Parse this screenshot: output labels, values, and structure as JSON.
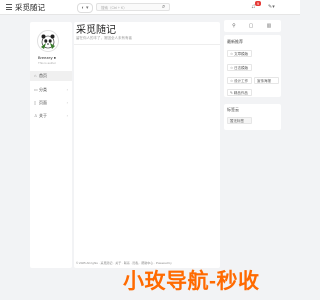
{
  "header": {
    "site_title": "采觅随记",
    "theme_label": "◐ ▾",
    "search_placeholder": "搜索（Ctrl + K）",
    "notify_count": "9"
  },
  "profile": {
    "name": "Breezey ●",
    "subtitle": "This is author"
  },
  "nav": {
    "items": [
      {
        "label": "首页",
        "icon": "home-icon"
      },
      {
        "label": "分类",
        "icon": "folder-icon"
      },
      {
        "label": "页面",
        "icon": "page-icon"
      },
      {
        "label": "关于",
        "icon": "person-icon"
      }
    ]
  },
  "main": {
    "title": "采觅随记",
    "subtitle": "留在你人的丰了，常因全人未有有者"
  },
  "right": {
    "tools_title": "最新推荐",
    "buttons": [
      "☆ 文章模版",
      "☆ 日志模版",
      "☆ 设计工作",
      "宣传海报",
      "✎ 精品作品"
    ],
    "tags_title": "标签云",
    "tag": "暂无标签"
  },
  "footer": {
    "text": "© 2025 All rights · 采觅随记 · 关于 · 联系 · 隐私 · 帮助中心 · Powered by"
  },
  "watermark": {
    "text": "小玫导航-秒收"
  }
}
